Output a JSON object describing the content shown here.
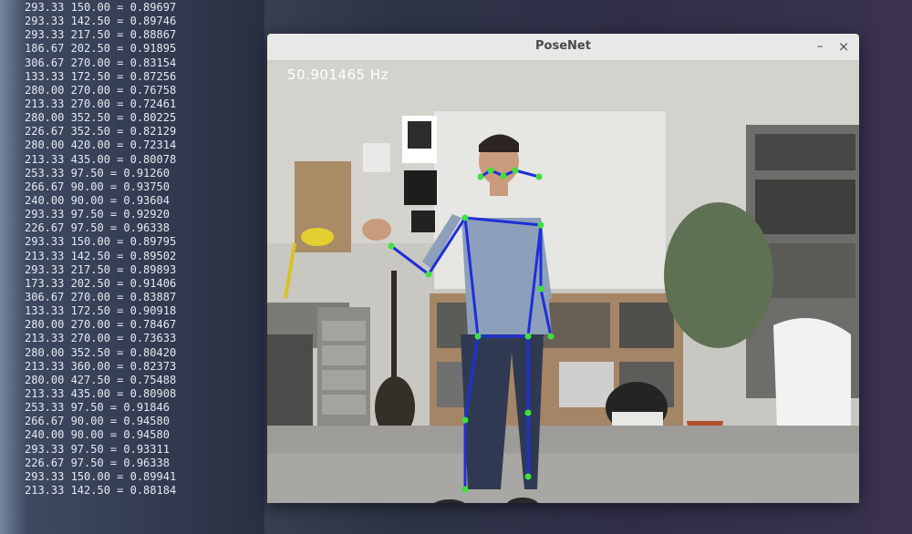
{
  "terminal": {
    "lines": [
      "293.33 150.00 = 0.89697",
      "293.33 142.50 = 0.89746",
      "293.33 217.50 = 0.88867",
      "186.67 202.50 = 0.91895",
      "306.67 270.00 = 0.83154",
      "133.33 172.50 = 0.87256",
      "280.00 270.00 = 0.76758",
      "213.33 270.00 = 0.72461",
      "280.00 352.50 = 0.80225",
      "226.67 352.50 = 0.82129",
      "280.00 420.00 = 0.72314",
      "213.33 435.00 = 0.80078",
      "253.33 97.50 = 0.91260",
      "266.67 90.00 = 0.93750",
      "240.00 90.00 = 0.93604",
      "293.33 97.50 = 0.92920",
      "226.67 97.50 = 0.96338",
      "293.33 150.00 = 0.89795",
      "213.33 142.50 = 0.89502",
      "293.33 217.50 = 0.89893",
      "173.33 202.50 = 0.91406",
      "306.67 270.00 = 0.83887",
      "133.33 172.50 = 0.90918",
      "280.00 270.00 = 0.78467",
      "213.33 270.00 = 0.73633",
      "280.00 352.50 = 0.80420",
      "213.33 360.00 = 0.82373",
      "280.00 427.50 = 0.75488",
      "213.33 435.00 = 0.80908",
      "253.33 97.50 = 0.91846",
      "266.67 90.00 = 0.94580",
      "240.00 90.00 = 0.94580",
      "293.33 97.50 = 0.93311",
      "226.67 97.50 = 0.96338",
      "293.33 150.00 = 0.89941",
      "213.33 142.50 = 0.88184"
    ]
  },
  "window": {
    "title": "PoseNet",
    "minimize_glyph": "–",
    "close_glyph": "×"
  },
  "overlay": {
    "fps_text": "50.901465  Hz"
  },
  "colors": {
    "skeleton_line": "#1f2fd8",
    "keypoint": "#3ee03e",
    "titlebar": "#e8e8e7"
  },
  "icons": {
    "minimize": "minimize-icon",
    "close": "close-icon"
  }
}
